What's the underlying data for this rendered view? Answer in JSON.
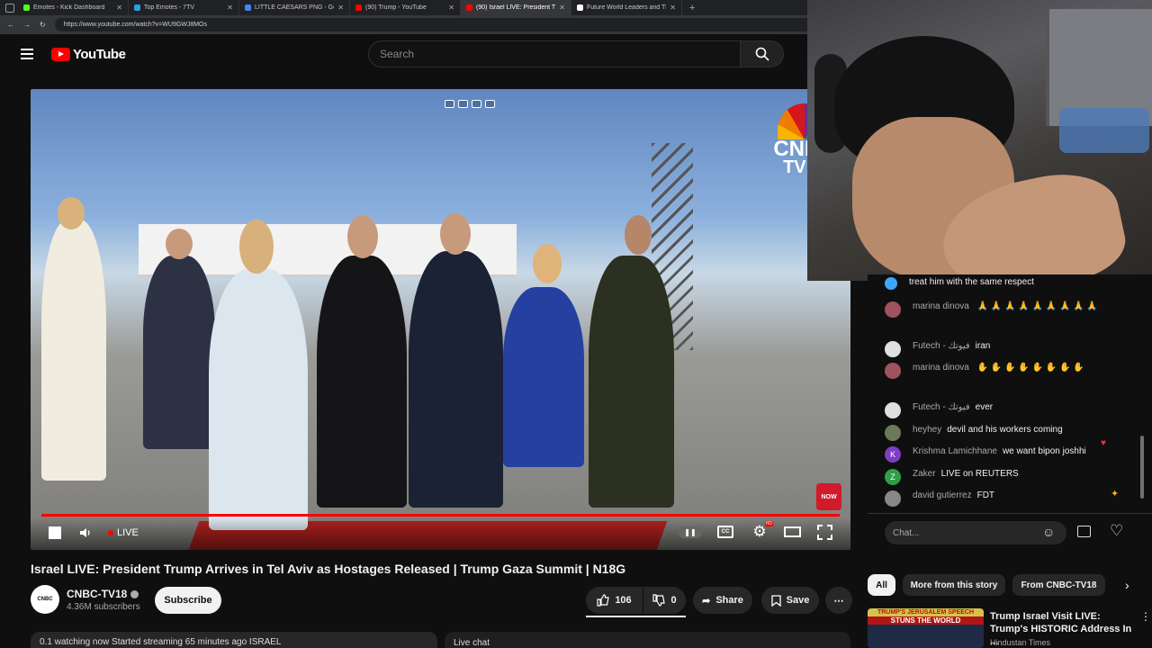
{
  "browser": {
    "tabs": [
      {
        "label": "Emotes - Kick Dashboard",
        "color": "#53fc18"
      },
      {
        "label": "Top Emotes - 7TV",
        "color": "#29a0e6"
      },
      {
        "label": "LITTLE CAESARS PNG - Google Se",
        "color": "#4285f4"
      },
      {
        "label": "(90) Trump - YouTube",
        "color": "#ff0000"
      },
      {
        "label": "(90) Israel LIVE: President Tru",
        "color": "#ff0000"
      },
      {
        "label": "Future World Leaders and Their",
        "color": "#ffffff"
      }
    ],
    "url": "https://www.youtube.com/watch?v=WU9GWJ8MOs"
  },
  "header": {
    "logo": "YouTube",
    "search_placeholder": "Search"
  },
  "player": {
    "live_label": "LIVE",
    "cnbc_name": "CNBC",
    "cnbc_sub": "TV18",
    "now_badge": "NOW",
    "hd_badge": "HD"
  },
  "video": {
    "title": "Israel LIVE: President Trump Arrives in Tel Aviv as Hostages Released | Trump Gaza Summit | N18G",
    "channel": "CNBC-TV18",
    "channel_avatar": "CNBC",
    "subscribers": "4.36M subscribers",
    "subscribe": "Subscribe",
    "likes": "106",
    "dislikes": "0",
    "share": "Share",
    "save": "Save",
    "more": "⋯"
  },
  "under": {
    "watching": "0.1 watching now  Started streaming 65 minutes ago  ISRAEL",
    "live_chat": "Live chat"
  },
  "chat": {
    "messages": [
      {
        "author": "",
        "text": "treat him with the same respect",
        "avatar_color": "#3ea6ff",
        "initial": ""
      },
      {
        "author": "marina dinova",
        "text": "🙏 🙏 🙏 🙏 🙏 🙏 🙏 🙏 🙏",
        "avatar_color": "#a0525f",
        "initial": ""
      },
      {
        "author": "Futech - فيوتك",
        "text": "iran",
        "avatar_color": "#e0e0e0",
        "initial": ""
      },
      {
        "author": "marina dinova",
        "text": "✋ ✋ ✋ ✋ ✋ ✋ ✋ ✋",
        "avatar_color": "#a0525f",
        "initial": ""
      },
      {
        "author": "Futech - فيوتك",
        "text": "ever",
        "avatar_color": "#e0e0e0",
        "initial": ""
      },
      {
        "author": "heyhey",
        "text": "devil and his workers coming",
        "avatar_color": "#6a7a5a",
        "initial": ""
      },
      {
        "author": "Krishma Lamichhane",
        "text": "we want bipon joshhi",
        "avatar_color": "#7b3fc4",
        "initial": "K"
      },
      {
        "author": "Zaker",
        "text": "LIVE on REUTERS",
        "avatar_color": "#2e9e4a",
        "initial": "Z"
      },
      {
        "author": "david gutierrez",
        "text": "FDT",
        "avatar_color": "#888888",
        "initial": ""
      }
    ],
    "input_placeholder": "Chat..."
  },
  "chips": [
    "All",
    "More from this story",
    "From CNBC-TV18"
  ],
  "recommendation": {
    "thumb_line1": "TRUMP'S JERUSALEM SPEECH",
    "thumb_line2": "STUNS THE WORLD",
    "title": "Trump Israel Visit LIVE: Trump's HISTORIC Address In ...",
    "channel": "Hindustan Times"
  }
}
